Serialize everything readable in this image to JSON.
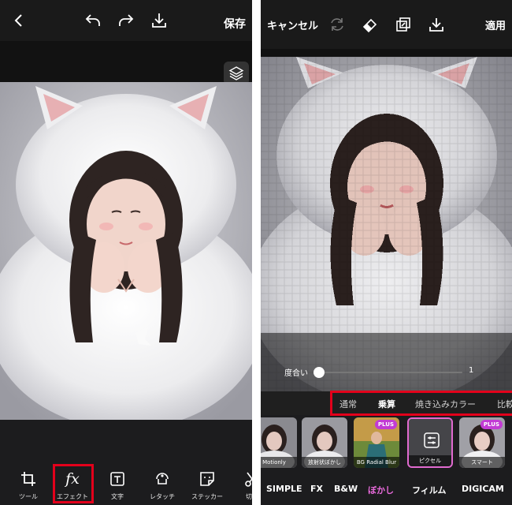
{
  "left_screen": {
    "header": {
      "back_icon": "chevron-left-icon",
      "undo_icon": "undo-icon",
      "redo_icon": "redo-icon",
      "download_icon": "download-icon",
      "save_label": "保存"
    },
    "layers_icon": "layers-icon",
    "toolbar": {
      "items": [
        {
          "label": "ツール",
          "icon": "crop-icon"
        },
        {
          "label": "エフェクト",
          "icon": "fx-icon",
          "glyph": "fx"
        },
        {
          "label": "文字",
          "icon": "text-icon"
        },
        {
          "label": "レタッチ",
          "icon": "retouch-icon"
        },
        {
          "label": "ステッカー",
          "icon": "sticker-icon"
        },
        {
          "label": "切り",
          "icon": "cutout-icon"
        }
      ],
      "highlighted_item": "エフェクト",
      "highlight_color": "#e3001b"
    }
  },
  "right_screen": {
    "header": {
      "cancel_label": "キャンセル",
      "apply_label": "適用",
      "icons": [
        "refresh-icon",
        "eraser-icon",
        "compare-icon",
        "download-icon"
      ]
    },
    "intensity": {
      "label": "度合い",
      "value": "1",
      "slider_level": 0
    },
    "blend_modes": {
      "items": [
        "通常",
        "乗算",
        "焼き込みカラー",
        "比較"
      ],
      "selected": "乗算",
      "highlight_color": "#e3001b"
    },
    "filters": {
      "items": [
        {
          "label": "Motionly",
          "plus": false
        },
        {
          "label": "放射状ぼかし",
          "plus": false
        },
        {
          "label": "BG Radial Blur",
          "plus": true
        },
        {
          "label": "ピクセル",
          "plus": false,
          "selected": true
        },
        {
          "label": "スマート",
          "plus": true
        }
      ],
      "plus_badge": "PLUS",
      "selected_border_color": "#e16ad0"
    },
    "categories": {
      "items": [
        "SIMPLE",
        "FX",
        "B&W",
        "ぼかし",
        "フィルム",
        "DIGICAM"
      ],
      "selected": "ぼかし",
      "selected_color": "#e86adb"
    }
  }
}
